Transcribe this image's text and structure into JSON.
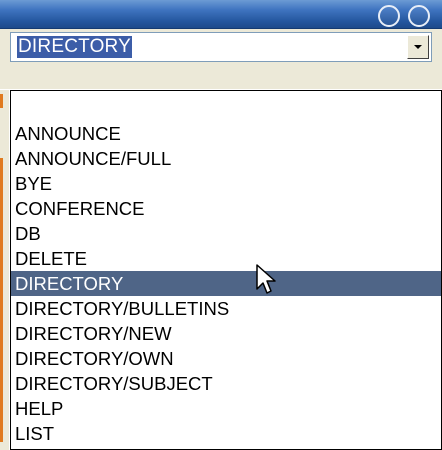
{
  "combo": {
    "value": "DIRECTORY",
    "arrow_icon": "chevron-down-icon"
  },
  "titlebar": {
    "icons": [
      "ring-icon",
      "ring-icon"
    ]
  },
  "dropdown": {
    "items": [
      {
        "label": ""
      },
      {
        "label": "ANNOUNCE"
      },
      {
        "label": "ANNOUNCE/FULL"
      },
      {
        "label": "BYE"
      },
      {
        "label": "CONFERENCE"
      },
      {
        "label": "DB"
      },
      {
        "label": "DELETE"
      },
      {
        "label": "DIRECTORY",
        "selected": true
      },
      {
        "label": "DIRECTORY/BULLETINS"
      },
      {
        "label": "DIRECTORY/NEW"
      },
      {
        "label": "DIRECTORY/OWN"
      },
      {
        "label": "DIRECTORY/SUBJECT"
      },
      {
        "label": "HELP"
      },
      {
        "label": "LIST"
      }
    ]
  },
  "colors": {
    "selection": "#4f6587",
    "combo_selection": "#3c5da8",
    "titlebar": "#2a5ea8",
    "accent_orange": "#e07a1f"
  },
  "cursor": "arrow-cursor-icon"
}
